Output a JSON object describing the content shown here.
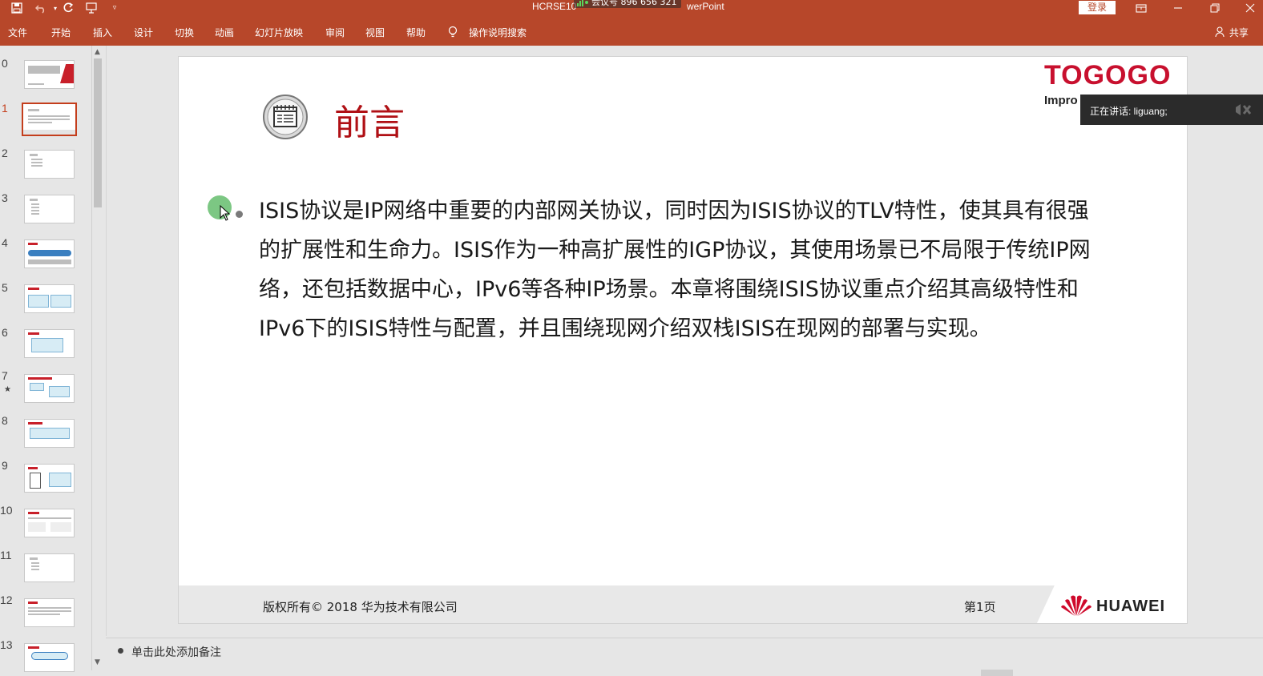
{
  "window": {
    "title": "HCRSE10",
    "title_tail": "werPoint",
    "meeting_badge": "会议号 896 656 321",
    "login": "登录"
  },
  "ribbon": {
    "tabs": [
      "文件",
      "开始",
      "插入",
      "设计",
      "切换",
      "动画",
      "幻灯片放映",
      "审阅",
      "视图",
      "帮助",
      "操作说明搜索"
    ],
    "share": "共享"
  },
  "thumbnails": {
    "numbers": [
      "0",
      "1",
      "2",
      "3",
      "4",
      "5",
      "6",
      "7",
      "8",
      "9",
      "10",
      "11",
      "12",
      "13"
    ],
    "active_index": 1,
    "star_label": "★"
  },
  "slide": {
    "title": "前言",
    "logo": "TOGOGO",
    "logo_sub": "Impro",
    "body": "ISIS协议是IP网络中重要的内部网关协议，同时因为ISIS协议的TLV特性，使其具有很强的扩展性和生命力。ISIS作为一种高扩展性的IGP协议，其使用场景已不局限于传统IP网络，还包括数据中心，IPv6等各种IP场景。本章将围绕ISIS协议重点介绍其高级特性和IPv6下的ISIS特性与配置，并且围绕现网介绍双栈ISIS在现网的部署与实现。",
    "copyright": "版权所有© 2018 华为技术有限公司",
    "page": "第1页",
    "brand": "HUAWEI"
  },
  "speaker": {
    "text": "正在讲话: liguang;"
  },
  "notes": {
    "placeholder": "单击此处添加备注"
  },
  "colors": {
    "accent": "#b7472a",
    "title_red": "#b01015",
    "logo_red": "#c8102e"
  }
}
